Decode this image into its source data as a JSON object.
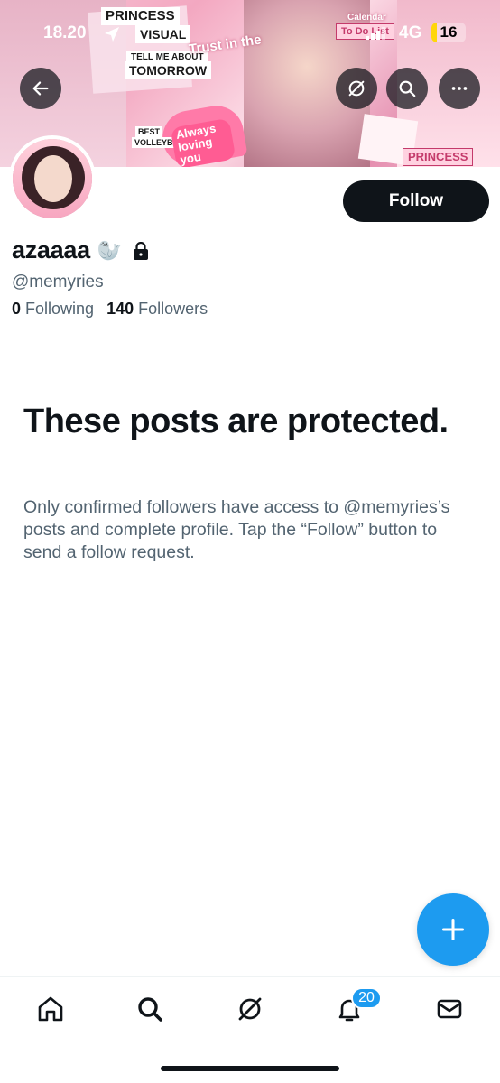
{
  "status_bar": {
    "time": "18.20",
    "network": "4G",
    "battery": "16",
    "battery_level": 0.16
  },
  "banner": {
    "stickers": [
      "PRINCESS",
      "VISUAL",
      "TELL ME ABOUT",
      "TOMORROW",
      "Trust in the",
      "To Do List",
      "Calendar",
      "BEST",
      "VOLLEYBALL",
      "Always loving you",
      "PRINCESS"
    ]
  },
  "nav": {
    "back_icon": "arrow-left-icon",
    "grok_icon": "grok-icon",
    "search_icon": "search-icon",
    "more_icon": "more-icon"
  },
  "profile": {
    "display_name": "azaaaa",
    "emoji": "🦭",
    "handle": "@memyries",
    "following_count": "0",
    "following_label": "Following",
    "followers_count": "140",
    "followers_label": "Followers",
    "follow_button": "Follow"
  },
  "protected": {
    "title": "These posts are protected.",
    "body": "Only confirmed followers have access to @memyries’s posts and complete profile. Tap the “Follow” button to send a follow request."
  },
  "fab": {
    "icon": "plus-icon",
    "color": "#1d9bf0"
  },
  "tabbar": {
    "items": [
      "home-icon",
      "search-icon",
      "grok-icon",
      "notifications-icon",
      "messages-icon"
    ],
    "notifications_badge": "20"
  },
  "colors": {
    "accent": "#1d9bf0",
    "text": "#0f1419",
    "secondary": "#536471"
  }
}
